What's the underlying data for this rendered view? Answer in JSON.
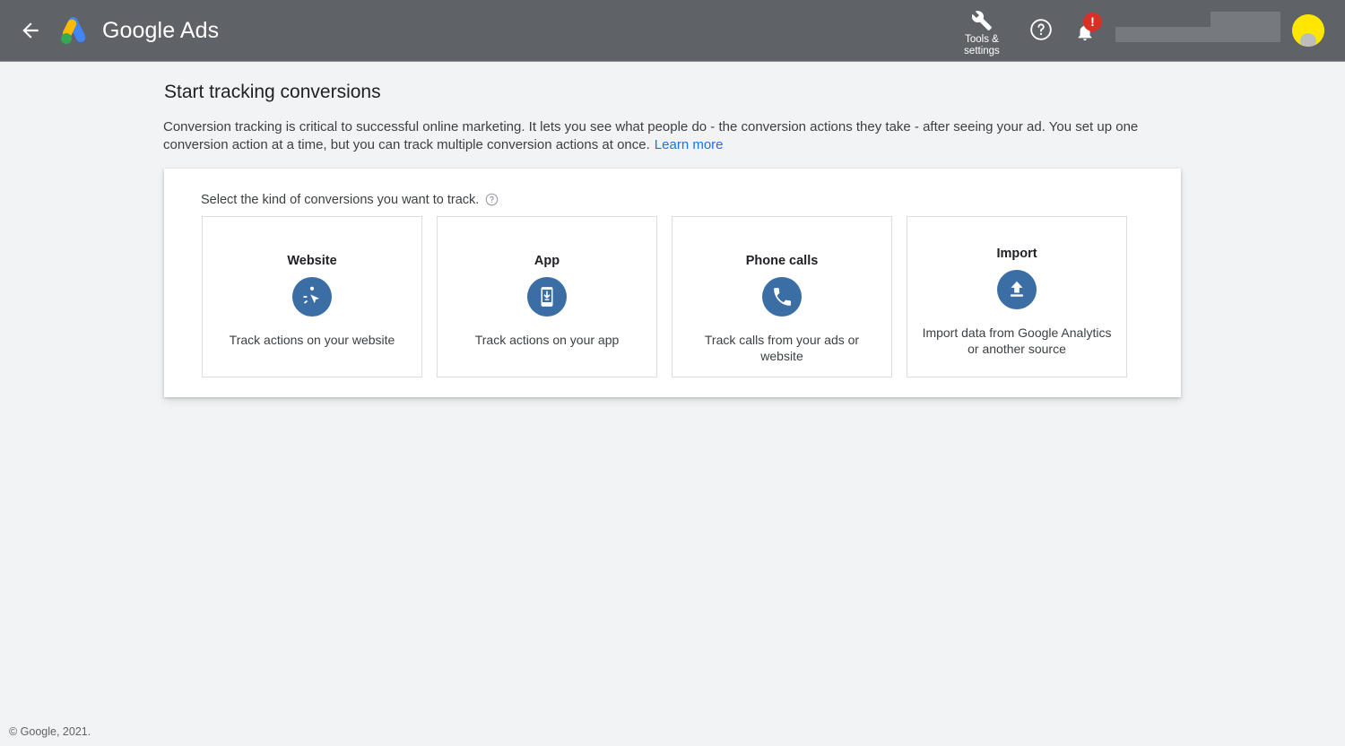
{
  "header": {
    "back_icon": "back-arrow-icon",
    "logo_icon": "google-ads-logo-icon",
    "brand_bold": "Google",
    "brand_thin": "Ads",
    "tools_icon": "wrench-icon",
    "tools_label_line1": "Tools &",
    "tools_label_line2": "settings",
    "help_icon": "help-circle-icon",
    "bell_icon": "notification-bell-icon",
    "bell_badge": "!",
    "avatar_icon": "user-avatar-icon",
    "background_color": "#5f6368",
    "badge_color": "#d93025",
    "avatar_color": "#ffe600"
  },
  "main": {
    "title": "Start tracking conversions",
    "description": "Conversion tracking is critical to successful online marketing. It lets you see what people do - the conversion actions they take - after seeing your ad. You set up one conversion action at a time, but you can track multiple conversion actions at once.",
    "learn_more": "Learn more",
    "link_color": "#1a73e8",
    "panel": {
      "label": "Select the kind of conversions you want to track.",
      "help_icon": "help-circle-icon",
      "accent_color": "#3a6ea5",
      "cards": [
        {
          "title": "Website",
          "description": "Track actions on your website",
          "icon": "cursor-click-icon"
        },
        {
          "title": "App",
          "description": "Track actions on your app",
          "icon": "mobile-download-icon"
        },
        {
          "title": "Phone calls",
          "description": "Track calls from your ads or website",
          "icon": "phone-icon"
        },
        {
          "title": "Import",
          "description": "Import data from Google Analytics or another source",
          "icon": "upload-icon"
        }
      ]
    }
  },
  "footer": {
    "copyright": "© Google, 2021."
  }
}
